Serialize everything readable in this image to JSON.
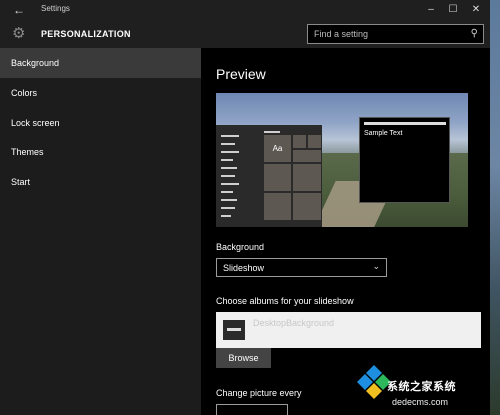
{
  "titlebar": {
    "app_title": "Settings"
  },
  "header": {
    "section_title": "PERSONALIZATION"
  },
  "search": {
    "placeholder": "Find a setting"
  },
  "sidebar": {
    "items": [
      {
        "label": "Background",
        "active": true
      },
      {
        "label": "Colors",
        "active": false
      },
      {
        "label": "Lock screen",
        "active": false
      },
      {
        "label": "Themes",
        "active": false
      },
      {
        "label": "Start",
        "active": false
      }
    ]
  },
  "main": {
    "preview_title": "Preview",
    "preview": {
      "tile_label": "Aa",
      "sample_text": "Sample Text"
    },
    "background_label": "Background",
    "background_value": "Slideshow",
    "albums_label": "Choose albums for your slideshow",
    "album_name": "DesktopBackground",
    "browse_label": "Browse",
    "change_label": "Change picture every"
  },
  "watermark": {
    "text": "系统之家系统",
    "url": "dedecms.com"
  },
  "colors": {
    "accent": "#0078d7",
    "sidebar_bg": "#1c1c1c",
    "active_item": "#3a3a3a"
  }
}
